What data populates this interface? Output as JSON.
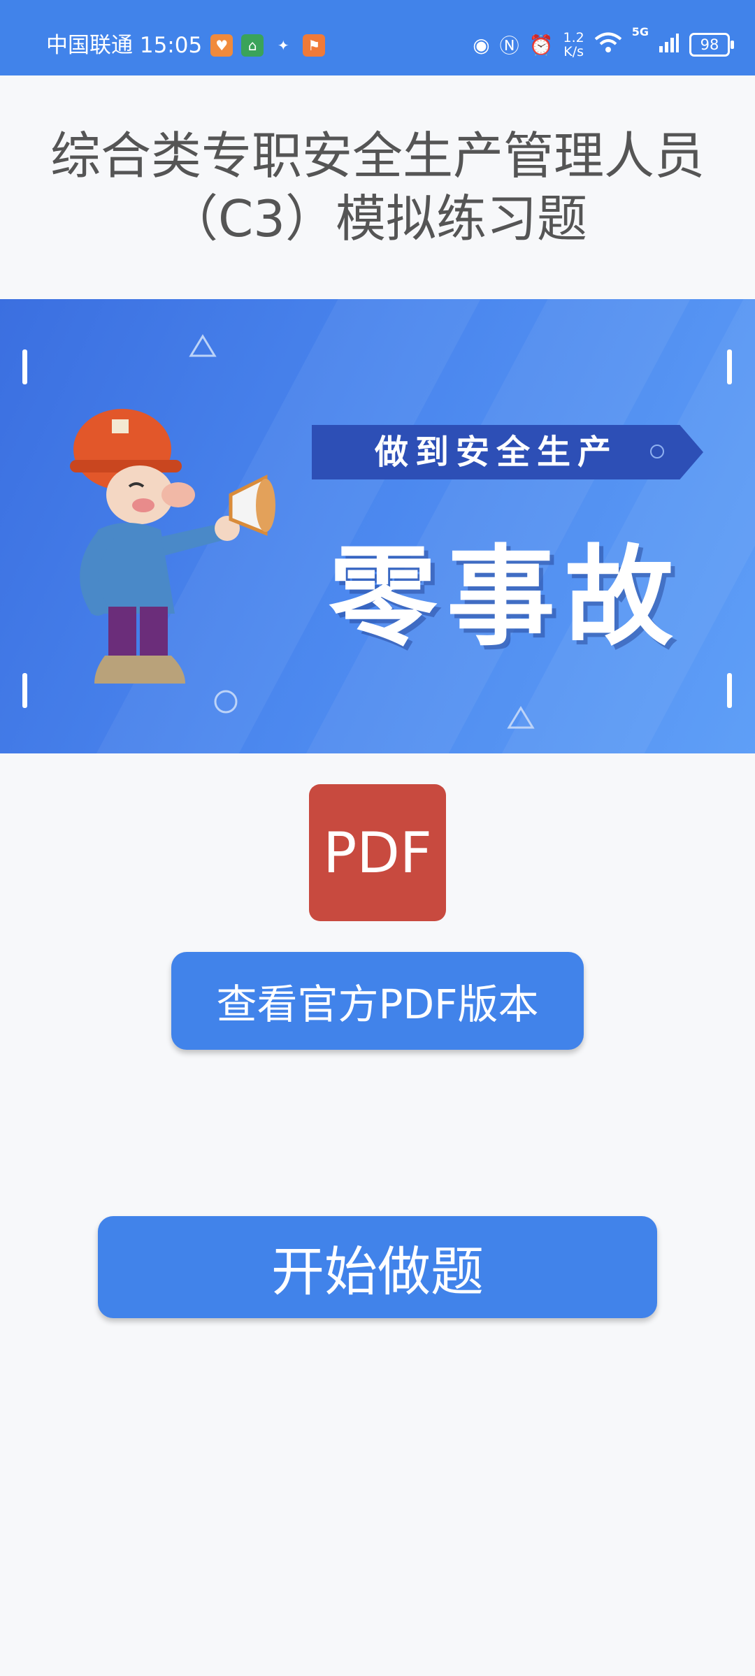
{
  "status_bar": {
    "carrier_time": "中国联通 15:05",
    "net_speed_value": "1.2",
    "net_speed_unit": "K/s",
    "network": "5G",
    "battery": "98"
  },
  "title": "综合类专职安全生产管理人员（C3）模拟练习题",
  "banner": {
    "ribbon_text": "做到安全生产",
    "main_text": "零事故"
  },
  "pdf_tile": "PDF",
  "buttons": {
    "view_pdf": "查看官方PDF版本",
    "start": "开始做题"
  },
  "colors": {
    "primary": "#4183ea",
    "pdf_red": "#c84a3f",
    "background": "#f7f8fa"
  }
}
